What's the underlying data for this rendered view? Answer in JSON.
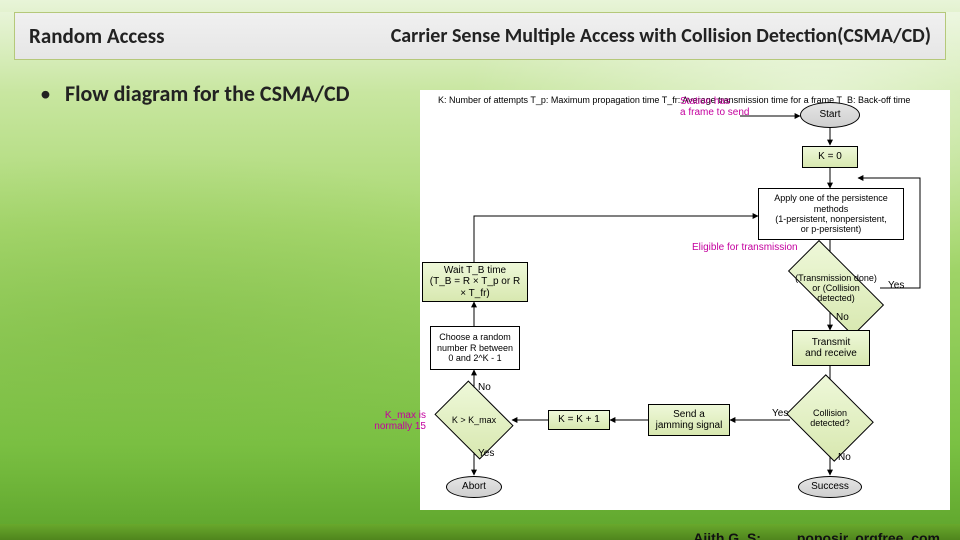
{
  "banner": {
    "left": "Random Access",
    "right": "Carrier Sense Multiple Access  with Collision Detection(CSMA/CD)"
  },
  "bullet": "Flow diagram for the CSMA/CD",
  "annotations": {
    "send_frame": "Station has\na frame to send",
    "eligible": "Eligible for transmission",
    "kmax": "K_max is\nnormally 15",
    "yes1": "Yes",
    "no1": "No",
    "yes2": "Yes",
    "no2": "No",
    "yes3": "Yes",
    "no3": "No"
  },
  "legend": "K: Number of attempts\nT_p: Maximum propagation time\nT_fr: Average transmission time for a frame\nT_B: Back-off time",
  "nodes": {
    "start": "Start",
    "k0": "K = 0",
    "persist": "Apply one of the persistence methods\n(1-persistent, nonpersistent,\nor p-persistent)",
    "tx_done": "(Transmission done) or\n(Collision detected)",
    "tx_recv": "Transmit\nand receive",
    "jam": "Send a\njamming signal",
    "coll": "Collision\ndetected?",
    "kinc": "K = K + 1",
    "kgt": "K > K_max",
    "choose": "Choose a random\nnumber R between\n0 and 2^K - 1",
    "wait": "Wait T_B time\n(T_B = R × T_p or R × T_fr)",
    "abort": "Abort",
    "success": "Success"
  },
  "footer": {
    "name": "Ajith G. S:",
    "site": "poposir. orgfree. com"
  }
}
